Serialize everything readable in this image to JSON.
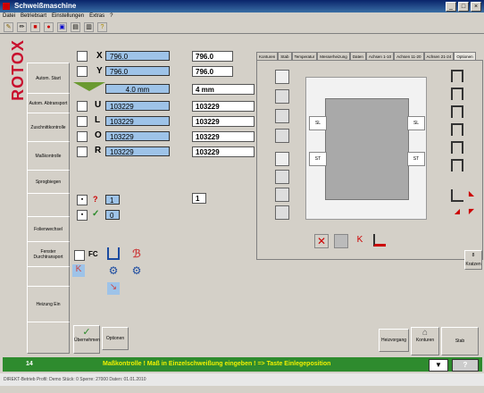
{
  "window": {
    "title": "Schweißmaschine"
  },
  "menu": [
    "Datei",
    "Betriebsart",
    "Einstellungen",
    "Extras",
    "?"
  ],
  "logo": "ROTOX",
  "sidebar": [
    "Autom. Start",
    "Autom. Abtransport",
    "Zuschnittkontrolle",
    "Maßkontrolle",
    "Sprogbiegen",
    "",
    "Folienwechsel",
    "Fenster Durchtransport",
    "",
    "Heizung Ein",
    ""
  ],
  "params": [
    {
      "label": "X",
      "value": "796.0",
      "out": "796.0"
    },
    {
      "label": "Y",
      "value": "796.0",
      "out": "796.0"
    },
    {
      "label": "",
      "value": "4.0 mm",
      "out": "4 mm"
    },
    {
      "label": "U",
      "value": "103229",
      "out": "103229"
    },
    {
      "label": "L",
      "value": "103229",
      "out": "103229"
    },
    {
      "label": "O",
      "value": "103229",
      "out": "103229"
    },
    {
      "label": "R",
      "value": "103229",
      "out": "103229"
    }
  ],
  "counter": {
    "a": "1",
    "b": "0",
    "out": "1"
  },
  "fc_label": "FC",
  "tabs": [
    "Konturen",
    "Stab",
    "Temperatur",
    "Messerheizung",
    "Daten",
    "Achsen 1-10",
    "Achsen 11-20",
    "Achsen 21-24",
    "Optionen"
  ],
  "frame_labels": {
    "sl_left": "SL",
    "sl_right": "SL",
    "st_left": "ST",
    "st_right": "ST"
  },
  "buttons": {
    "uebernehmen": "Übernehmen",
    "optionen": "Optionen",
    "heizung": "Heizvorgang",
    "konturen": "Konturen",
    "stab": "Stab",
    "kratzen": "Kratzen",
    "counter8": "8"
  },
  "status": {
    "number": "14",
    "message": "Maßkontrolle ! Maß in Einzelschweißung eingeben ! => Taste Einlegeposition"
  },
  "footer": "DIREKT-Betrieb   Profil: Demo   Stück: 0   Sperre: 27000   Daten: 01.01.2010"
}
